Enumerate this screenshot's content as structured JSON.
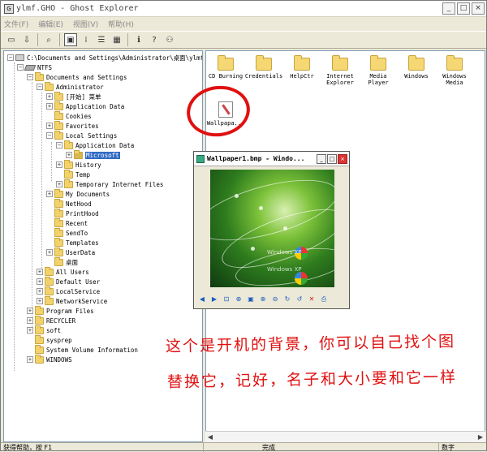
{
  "window": {
    "title": "ylmf.GHO - Ghost Explorer",
    "buttons": {
      "minimize": "_",
      "maximize": "□",
      "close": "×"
    }
  },
  "menu": [
    "文件(F)",
    "编辑(E)",
    "视图(V)",
    "帮助(H)"
  ],
  "toolbar": {
    "icons": [
      "open-icon",
      "extract-icon",
      "search-icon",
      "large-icons-view-icon",
      "small-icons-view-icon",
      "list-view-icon",
      "details-view-icon",
      "info-icon",
      "help-icon",
      "about-icon"
    ]
  },
  "tree": {
    "root": "C:\\Documents and Settings\\Administrator\\桌面\\ylmf.GHO",
    "items": [
      {
        "label": "NTFS"
      },
      {
        "label": "Documents and Settings"
      },
      {
        "label": "Administrator"
      },
      {
        "label": "[开始] 菜单"
      },
      {
        "label": "Application Data"
      },
      {
        "label": "Cookies"
      },
      {
        "label": "Favorites"
      },
      {
        "label": "Local Settings"
      },
      {
        "label": "Application Data"
      },
      {
        "label": "Microsoft"
      },
      {
        "label": "History"
      },
      {
        "label": "Temp"
      },
      {
        "label": "Temporary Internet Files"
      },
      {
        "label": "My Documents"
      },
      {
        "label": "NetHood"
      },
      {
        "label": "PrintHood"
      },
      {
        "label": "Recent"
      },
      {
        "label": "SendTo"
      },
      {
        "label": "Templates"
      },
      {
        "label": "UserData"
      },
      {
        "label": "桌面"
      },
      {
        "label": "All Users"
      },
      {
        "label": "Default User"
      },
      {
        "label": "LocalService"
      },
      {
        "label": "NetworkService"
      },
      {
        "label": "Program Files"
      },
      {
        "label": "RECYCLER"
      },
      {
        "label": "soft"
      },
      {
        "label": "sysprep"
      },
      {
        "label": "System Volume Information"
      },
      {
        "label": "WINDOWS"
      }
    ]
  },
  "files": [
    {
      "label": "CD Burning",
      "icon": "folder-icon"
    },
    {
      "label": "Credentials",
      "icon": "folder-icon"
    },
    {
      "label": "HelpCtr",
      "icon": "folder-icon"
    },
    {
      "label": "Internet Explorer",
      "icon": "folder-icon"
    },
    {
      "label": "Media Player",
      "icon": "folder-icon"
    },
    {
      "label": "Windows",
      "icon": "folder-icon"
    },
    {
      "label": "Windows Media",
      "icon": "folder-icon"
    },
    {
      "label": "Wallpapa...",
      "icon": "bitmap-file-icon"
    }
  ],
  "viewer": {
    "title": "Wallpaper1.bmp - Windo...",
    "watermark": "Windows XP",
    "tools": [
      "prev-icon",
      "next-icon",
      "best-fit-icon",
      "actual-size-icon",
      "slideshow-icon",
      "zoom-in-icon",
      "zoom-out-icon",
      "rotate-cw-icon",
      "rotate-ccw-icon",
      "delete-icon",
      "print-icon"
    ]
  },
  "annotation": {
    "line1": "这个是开机的背景，你可以自己找个图",
    "line2": "替换它，记好，名子和大小要和它一样",
    "color": "#e01010"
  },
  "status": {
    "help": "获得帮助，按 F1",
    "state": "完成",
    "numlock": "数字"
  }
}
